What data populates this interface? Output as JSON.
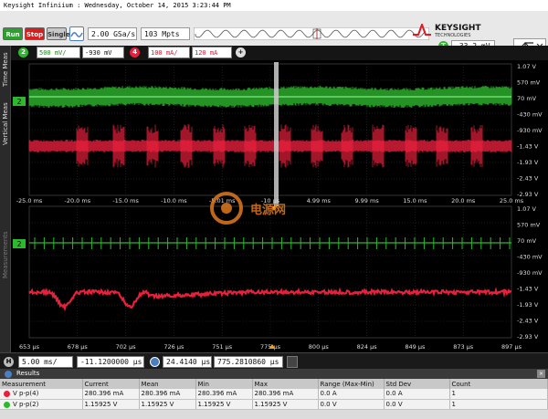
{
  "window": {
    "title": "Keysight Infiniium : Wednesday, October 14, 2015 3:23:44 PM"
  },
  "brand": {
    "name": "KEYSIGHT",
    "sub": "TECHNOLOGIES"
  },
  "controls": {
    "run": "Run",
    "stop": "Stop",
    "single": "Single"
  },
  "acquisition": {
    "sample_rate": "2.00 GSa/s",
    "memory_depth": "103 Mpts"
  },
  "trigger": {
    "channel": "T",
    "level": "-33.2 mV"
  },
  "channels": [
    {
      "id": "2",
      "scale": "500 mV/",
      "offset": "-930 mV",
      "color": "#2eb82e"
    },
    {
      "id": "4",
      "scale": "100 mA/",
      "offset": "120 mA",
      "color": "#e8203c"
    }
  ],
  "side_tabs": [
    "Time Meas",
    "Vertical Meas",
    "Measurements"
  ],
  "upper_display": {
    "y_labels": [
      "1.07 V",
      "570 mV",
      "70 mV",
      "-430 mV",
      "-930 mV",
      "-1.43 V",
      "-1.93 V",
      "-2.43 V",
      "-2.93 V"
    ],
    "x_labels": [
      "-25.0 ms",
      "-20.0 ms",
      "-15.0 ms",
      "-10.0 ms",
      "-5.01 ms",
      "-10 µs",
      "4.99 ms",
      "9.99 ms",
      "15.0 ms",
      "20.0 ms",
      "25.0 ms"
    ]
  },
  "lower_display": {
    "y_labels": [
      "1.07 V",
      "570 mV",
      "70 mV",
      "-430 mV",
      "-930 mV",
      "-1.43 V",
      "-1.93 V",
      "-2.43 V",
      "-2.93 V"
    ],
    "x_labels": [
      "653 µs",
      "678 µs",
      "702 µs",
      "726 µs",
      "751 µs",
      "775 µs",
      "800 µs",
      "824 µs",
      "849 µs",
      "873 µs",
      "897 µs"
    ]
  },
  "watermark": {
    "text": "电源网"
  },
  "timebase": {
    "h_label": "H",
    "scale": "5.00 ms/",
    "position": "-11.1200000 µs",
    "zoom_scale": "24.4140 µs/",
    "zoom_position": "775.2810860 µs"
  },
  "results": {
    "title": "Results",
    "columns": [
      "Measurement",
      "Current",
      "Mean",
      "Min",
      "Max",
      "Range (Max-Min)",
      "Std Dev",
      "Count"
    ],
    "rows": [
      {
        "name": "V p-p(4)",
        "color": "#e8203c",
        "values": [
          "280.396 mA",
          "280.396 mA",
          "280.396 mA",
          "280.396 mA",
          "0.0 A",
          "0.0 A",
          "1"
        ]
      },
      {
        "name": "V p-p(2)",
        "color": "#2eb82e",
        "values": [
          "1.15925 V",
          "1.15925 V",
          "1.15925 V",
          "1.15925 V",
          "0.0 V",
          "0.0 V",
          "1"
        ]
      }
    ]
  }
}
